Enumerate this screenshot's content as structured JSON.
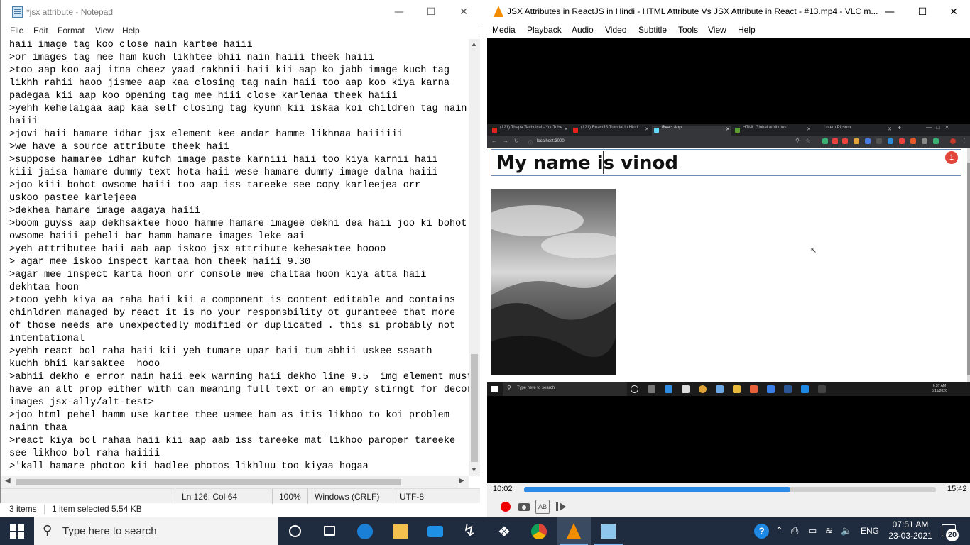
{
  "explorer": {
    "items": "3 items",
    "selected": "1 item selected  5.54 KB"
  },
  "notepad": {
    "title": "*jsx attribute - Notepad",
    "menu": [
      "File",
      "Edit",
      "Format",
      "View",
      "Help"
    ],
    "lines": [
      "haii image tag koo close nain kartee haiii",
      ">or images tag mee ham kuch likhtee bhii nain haiii theek haiii",
      ">too aap koo aaj itna cheez yaad rakhnii haii kii aap ko jabb image kuch tag",
      "likhh rahii haoo jismee aap kaa closing tag nain haii too aap koo kiya karna",
      "padegaa kii aap koo opening tag mee hiii close karlenaa theek haiii",
      ">yehh kehelaigaa aap kaa self closing tag kyunn kii iskaa koi children tag nain",
      "haiii",
      ">jovi haii hamare idhar jsx element kee andar hamme likhnaa haiiiiii",
      ">we have a source attribute theek haii",
      ">suppose hamaree idhar kufch image paste karniii haii too kiya karnii haii",
      "kiii jaisa hamare dummy text hota haii wese hamare dummy image dalna haiii",
      ">joo kiii bohot owsome haiii too aap iss tareeke see copy karleejea orr",
      "uskoo pastee karlejeea",
      ">dekhea hamare image aagaya haiii",
      ">boom guyss aap dekhsaktee hooo hamme hamare imagee dekhi dea haii joo ki bohot",
      "owsome haiii peheli bar hamm hamare images leke aai",
      ">yeh attributee haii aab aap iskoo jsx attribute kehesaktee hoooo",
      "> agar mee iskoo inspect kartaa hon theek haiii 9.30",
      ">agar mee inspect karta hoon orr console mee chaltaa hoon kiya atta haii",
      "dekhtaa hoon",
      ">tooo yehh kiya aa raha haii kii a component is content editable and contains",
      "chinldren managed by react it is no your responsbility ot guranteee that more",
      "of those needs are unexpectedly modified or duplicated . this si probably not",
      "intentational",
      ">yehh react bol raha haii kii yeh tumare upar haii tum abhii uskee ssaath",
      "kuchh bhii karsaktee  hooo",
      ">abhii dekho e error nain haii eek warning haii dekho line 9.5  img element must",
      "have an alt prop either with can meaning full text or an empty stirngt for decora",
      "images jsx-ally/alt-test>",
      ">joo html pehel hamm use kartee thee usmee ham as itis likhoo to koi problem",
      "nainn thaa",
      ">react kiya bol rahaa haii kii aap aab iss tareeke mat likhoo paroper tareeke",
      "see likhoo bol raha haiiii",
      ">'kall hamare photoo kii badlee photos likhluu too kiyaa hogaa"
    ],
    "status": {
      "position": "Ln 126, Col 64",
      "zoom": "100%",
      "line_ending": "Windows (CRLF)",
      "encoding": "UTF-8"
    }
  },
  "vlc": {
    "title": "JSX Attributes in ReactJS in Hindi - HTML Attribute Vs JSX Attribute in React  - #13.mp4 - VLC m...",
    "menu": [
      "Media",
      "Playback",
      "Audio",
      "Video",
      "Subtitle",
      "Tools",
      "View",
      "Help"
    ],
    "time_current": "10:02",
    "time_total": "15:42",
    "progress": 0.647,
    "video": {
      "tabs": [
        "(121) Thapa Technical - YouTube",
        "(121) ReactJS Tutorial in Hindi",
        "React App",
        "HTML Global attributes",
        "Lorem Picsum"
      ],
      "url": "localhost:3000",
      "heading": "My name is vinod",
      "notification_count": "1",
      "inner_search": "Type here to search",
      "inner_time": "6:37 AM",
      "inner_date": "5/11/2020"
    }
  },
  "taskbar": {
    "search_placeholder": "Type here to search",
    "language": "ENG",
    "time": "07:51 AM",
    "date": "23-03-2021",
    "notifications": "20"
  }
}
